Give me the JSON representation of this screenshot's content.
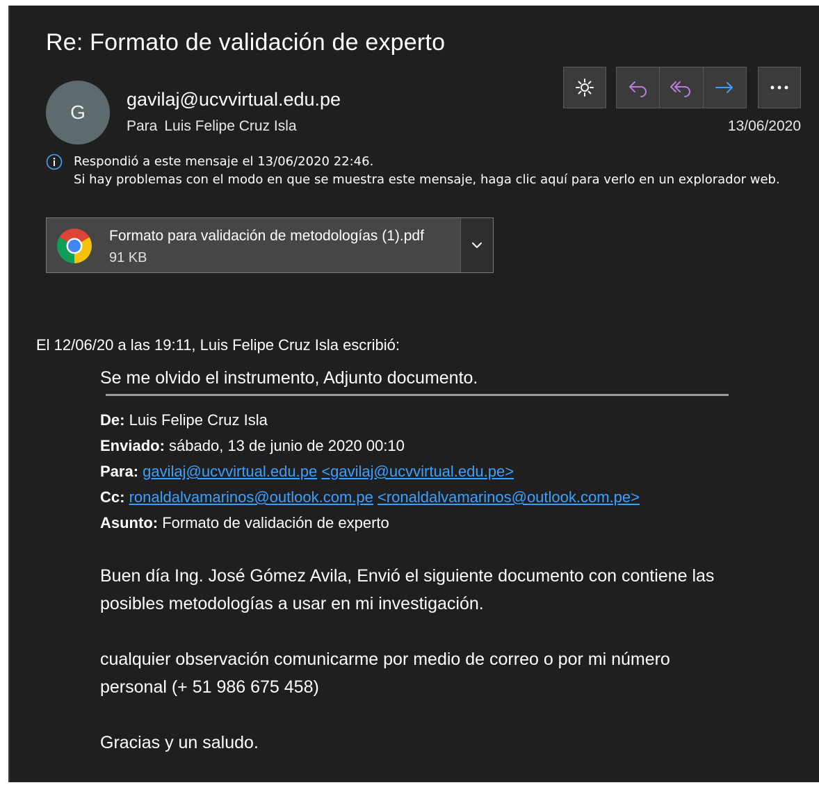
{
  "message": {
    "subject": "Re: Formato de validación de experto",
    "avatar_initial": "G",
    "sender": "gavilaj@ucvvirtual.edu.pe",
    "to_label": "Para",
    "to_name": "Luis Felipe Cruz Isla",
    "date": "13/06/2020"
  },
  "toolbar": {
    "icons": [
      "brightness-icon",
      "reply-icon",
      "reply-all-icon",
      "forward-icon",
      "more-icon"
    ],
    "accent_color": "#b87dd9",
    "forward_color": "#3ba0ff"
  },
  "info": {
    "line1": "Respondió a este mensaje el 13/06/2020 22:46.",
    "line2": "Si hay problemas con el modo en que se muestra este mensaje, haga clic aquí para verlo en un explorador web."
  },
  "attachment": {
    "name": "Formato para validación de metodologías (1).pdf",
    "size": "91 KB"
  },
  "quote": {
    "intro": "El 12/06/20 a las 19:11, Luis Felipe Cruz Isla escribió:",
    "first_line": "Se me olvido el instrumento, Adjunto documento.",
    "from_label": "De:",
    "from_value": "Luis Felipe Cruz Isla",
    "sent_label": "Enviado:",
    "sent_value": "sábado, 13 de junio de 2020 00:10",
    "to_label": "Para:",
    "to_link1": "gavilaj@ucvvirtual.edu.pe",
    "to_link2": "<gavilaj@ucvvirtual.edu.pe>",
    "cc_label": "Cc:",
    "cc_link1": "ronaldalvamarinos@outlook.com.pe",
    "cc_link2": "<ronaldalvamarinos@outlook.com.pe>",
    "subject_label": "Asunto:",
    "subject_value": "Formato de validación de experto",
    "para1_line1": "Buen día Ing. José Gómez Avila, Envió el siguiente documento con contiene las",
    "para1_line2": "posibles metodologías a usar en mi investigación.",
    "para2_line1": "cualquier observación comunicarme por medio de correo o por mi número",
    "para2_line2": "personal (+ 51 986 675 458)",
    "para3": "Gracias y un saludo."
  }
}
